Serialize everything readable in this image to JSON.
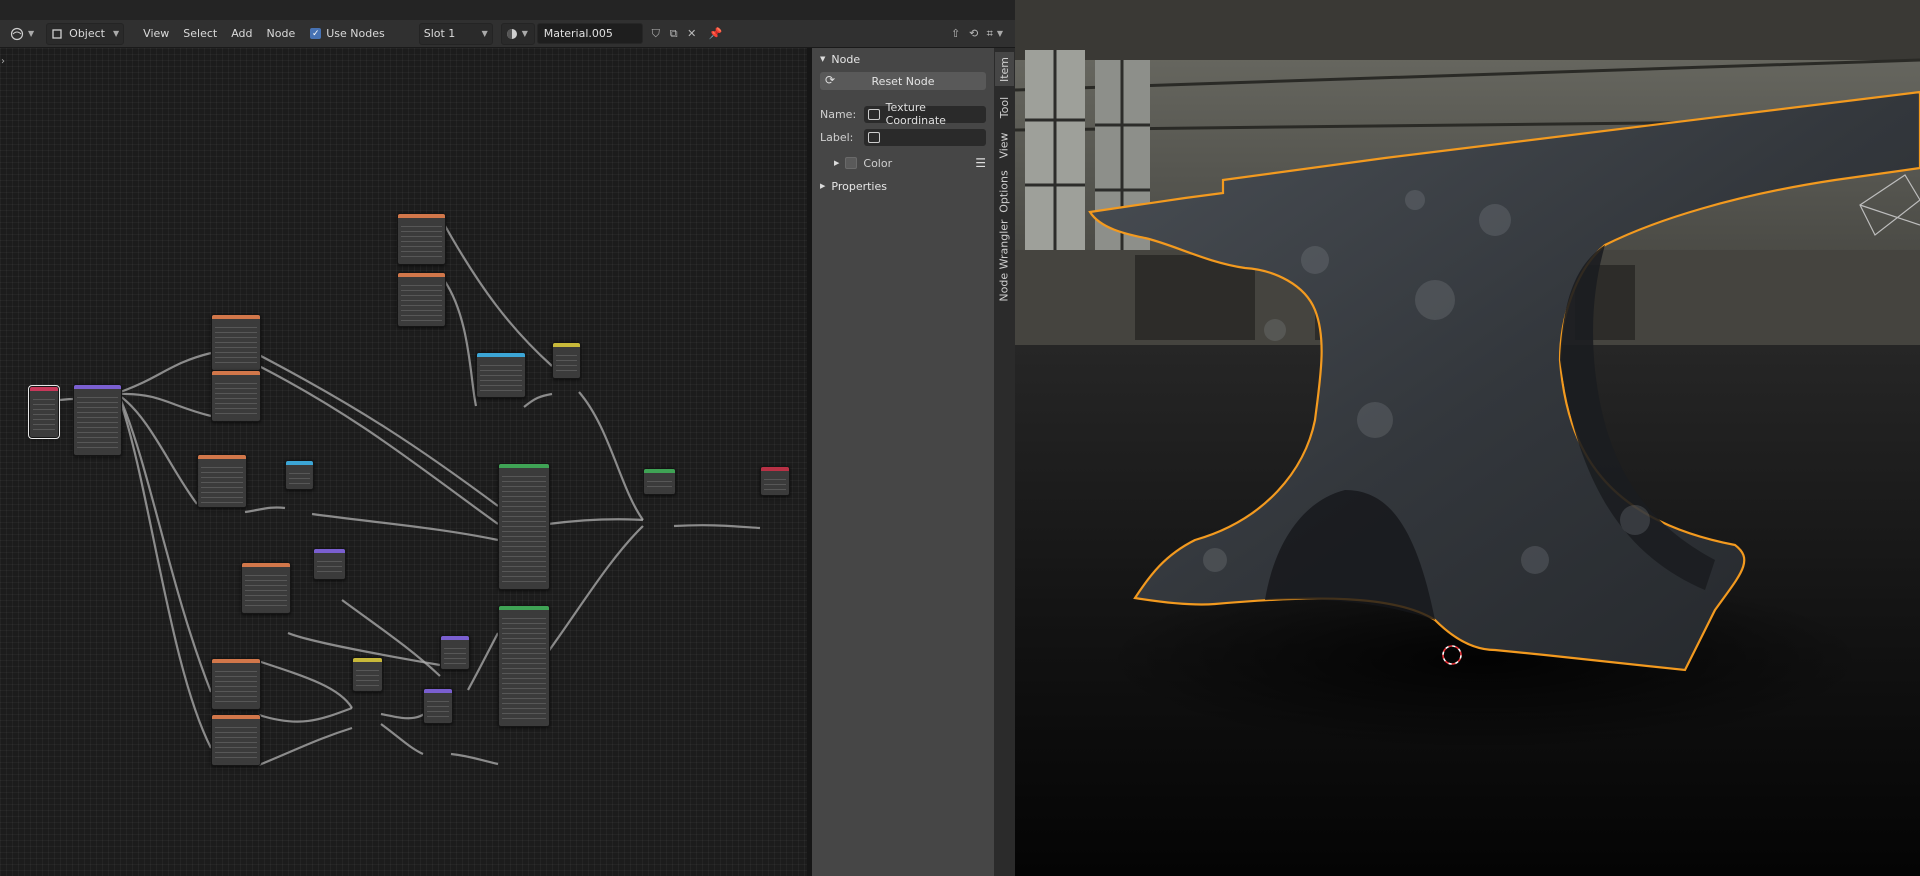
{
  "header": {
    "editor_type_icon": "node-editor-icon",
    "object_mode_icon": "object-cube-icon",
    "object_mode": "Object",
    "menus": [
      "View",
      "Select",
      "Add",
      "Node"
    ],
    "use_nodes_label": "Use Nodes",
    "use_nodes_checked": true,
    "slot": "Slot 1",
    "material_icon": "material-sphere-icon",
    "material_name": "Material.005",
    "right_icons": [
      "shield-icon",
      "duplicate-icon",
      "close-icon",
      "pin-icon",
      "parent-arrow-icon",
      "snap-icon",
      "gizmo-icon"
    ]
  },
  "sidebar": {
    "node_panel_title": "Node",
    "reset_node_label": "Reset Node",
    "name_label": "Name:",
    "name_value": "Texture Coordinate",
    "label_label": "Label:",
    "label_value": "",
    "color_label": "Color",
    "properties_label": "Properties",
    "tabs": [
      "Item",
      "Tool",
      "View",
      "Options",
      "Node Wrangler"
    ],
    "active_tab": "Item"
  },
  "colors": {
    "input": "#c8385a",
    "vector": "#7a5fd0",
    "texture": "#d2774a",
    "converter": "#3ca6d6",
    "color": "#c8b93a",
    "shader": "#3fa355",
    "output": "#b83145",
    "selection_outline": "#f5a623"
  }
}
